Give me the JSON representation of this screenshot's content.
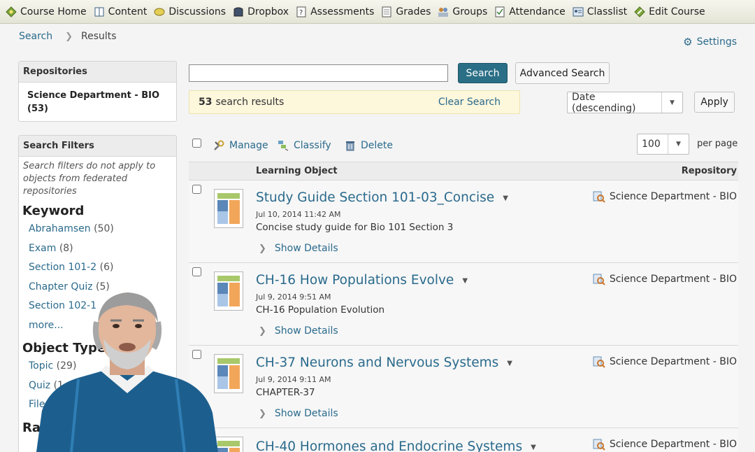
{
  "nav": {
    "items": [
      {
        "label": "Course Home",
        "icon": "course-home-icon"
      },
      {
        "label": "Content",
        "icon": "content-book-icon"
      },
      {
        "label": "Discussions",
        "icon": "discussions-bubble-icon"
      },
      {
        "label": "Dropbox",
        "icon": "dropbox-icon"
      },
      {
        "label": "Assessments",
        "icon": "assessments-quiz-icon"
      },
      {
        "label": "Grades",
        "icon": "grades-icon"
      },
      {
        "label": "Groups",
        "icon": "groups-icon"
      },
      {
        "label": "Attendance",
        "icon": "attendance-icon"
      },
      {
        "label": "Classlist",
        "icon": "classlist-icon"
      },
      {
        "label": "Edit Course",
        "icon": "edit-course-icon"
      }
    ]
  },
  "breadcrumb": {
    "search": "Search",
    "results": "Results"
  },
  "settings_label": "Settings",
  "repositories": {
    "header": "Repositories",
    "item": "Science Department - BIO (53)"
  },
  "filters": {
    "header": "Search Filters",
    "note": "Search filters do not apply to objects from federated repositories",
    "keyword_title": "Keyword",
    "keywords": [
      {
        "label": "Abrahamsen",
        "count": "(50)"
      },
      {
        "label": "Exam",
        "count": "(8)"
      },
      {
        "label": "Section 101-2",
        "count": "(6)"
      },
      {
        "label": "Chapter Quiz",
        "count": "(5)"
      },
      {
        "label": "Section 102-1",
        "count": ""
      }
    ],
    "more": "more...",
    "object_type_title": "Object Type",
    "object_types": [
      {
        "label": "Topic",
        "count": "(29)"
      },
      {
        "label": "Quiz",
        "count": "(1"
      },
      {
        "label": "File",
        "count": "("
      }
    ],
    "rating_title": "Rat"
  },
  "search": {
    "placeholder": "",
    "value": "",
    "button": "Search",
    "advanced": "Advanced Search"
  },
  "results": {
    "count": "53",
    "label": "search results",
    "clear": "Clear Search"
  },
  "sort": {
    "selected": "Date (descending)",
    "apply": "Apply"
  },
  "toolbar": {
    "manage": "Manage",
    "classify": "Classify",
    "delete": "Delete"
  },
  "paging": {
    "selected": "100",
    "label": "per page"
  },
  "table": {
    "col_object": "Learning Object",
    "col_repository": "Repository",
    "rows": [
      {
        "title": "Study Guide Section 101-03_Concise",
        "date": "Jul 10, 2014 11:42 AM",
        "desc": "Concise study guide for Bio 101 Section 3",
        "details": "Show Details",
        "repo": "Science Department - BIO"
      },
      {
        "title": "CH-16 How Populations Evolve",
        "date": "Jul 9, 2014 9:51 AM",
        "desc": "CH-16 Population Evolution",
        "details": "Show Details",
        "repo": "Science Department - BIO"
      },
      {
        "title": "CH-37 Neurons and Nervous Systems",
        "date": "Jul 9, 2014 9:11 AM",
        "desc": "CHAPTER-37",
        "details": "Show Details",
        "repo": "Science Department - BIO"
      },
      {
        "title": "CH-40 Hormones and Endocrine Systems",
        "date": "",
        "desc": "",
        "details": "",
        "repo": "Science Department - BIO"
      }
    ]
  },
  "colors": {
    "link": "#2a6a8c",
    "primary_button": "#2b6f86",
    "result_banner": "#fdf7dc"
  }
}
